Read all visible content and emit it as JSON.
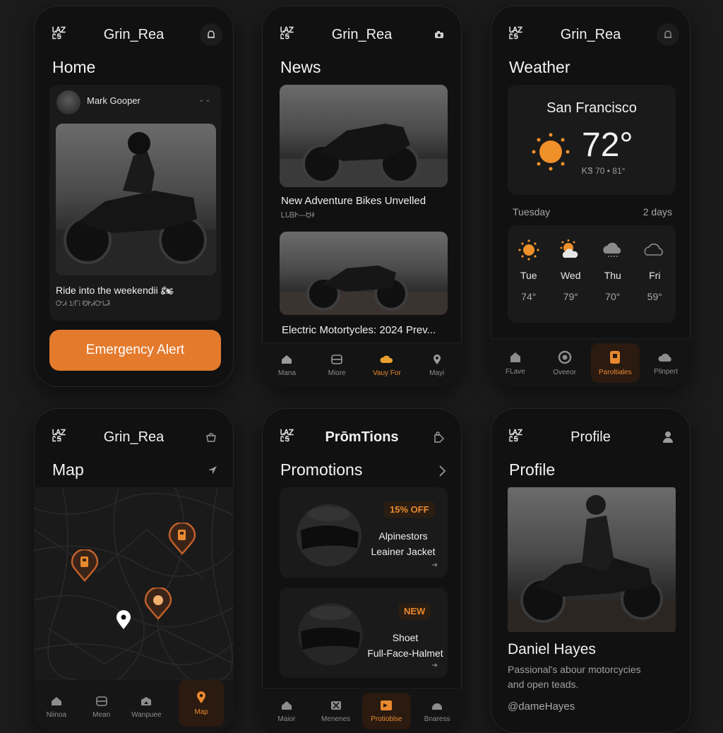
{
  "colors": {
    "accent": "#e47a2c",
    "background": "#1b1b1b",
    "phone": "#111111",
    "card": "#1a1a1a"
  },
  "logo": {
    "line1": "ᏓᎪᏃ",
    "line2": "ᏝᎦ"
  },
  "home": {
    "brand": "Grin_Rea",
    "title": "Home",
    "post": {
      "author": "Mark Gooper",
      "more": "⌄⌄",
      "caption": "Ride into the weekendii 🏍",
      "meta": "ᏅᏗ   1/ᎱᎥ   ᏬᎨᏗᏅᏓᏘ"
    },
    "emergency_label": "Emergency Alert"
  },
  "news": {
    "brand": "Grin_Rea",
    "title": "News",
    "items": [
      {
        "headline": "New Adventure Bikes Unvelled",
        "sub": "ᏞᏓᏴᎨ—ᏌᏐ"
      },
      {
        "headline": "Electric Motortycles: 2024 Prev..."
      }
    ],
    "nav": [
      "Mana",
      "Miore",
      "Vauy For",
      "Mayi"
    ]
  },
  "weather": {
    "brand": "Grin_Rea",
    "title": "Weather",
    "city": "San Francisco",
    "temp": "72°",
    "range": "ᏦᏕ 70 • 81°",
    "day_label": "Tuesday",
    "days_label": "2 days",
    "forecast": [
      {
        "day": "Tue",
        "temp": "74°",
        "icon": "sun-icon"
      },
      {
        "day": "Wed",
        "temp": "79°",
        "icon": "partly-cloudy-icon"
      },
      {
        "day": "Thu",
        "temp": "70°",
        "icon": "cloudy-icon"
      },
      {
        "day": "Fri",
        "temp": "59°",
        "icon": "cloud-icon"
      }
    ],
    "nav": [
      "FLave",
      "Oveeor",
      "Paroltiales",
      "Plinpert"
    ]
  },
  "map": {
    "brand": "Grin_Rea",
    "title": "Map",
    "nav": [
      "Niinoa",
      "Mean",
      "Wanpuee",
      "Map"
    ]
  },
  "promotions": {
    "brand": "PrōmTions",
    "title": "Promotions",
    "items": [
      {
        "badge": "15% OFF",
        "name": "Alpinestors\nLeainer Jacket"
      },
      {
        "badge": "NEW",
        "name": "Shoet\nFull-Face-Halmet"
      }
    ],
    "nav": [
      "Maior",
      "Menenes",
      "Protioblse",
      "Bnaress"
    ]
  },
  "profile": {
    "brand": "Profile",
    "title": "Profile",
    "name": "Daniel Hayes",
    "bio": "Passional's abour motorcycies\nand open teads.",
    "handle": "@dameHayes"
  }
}
